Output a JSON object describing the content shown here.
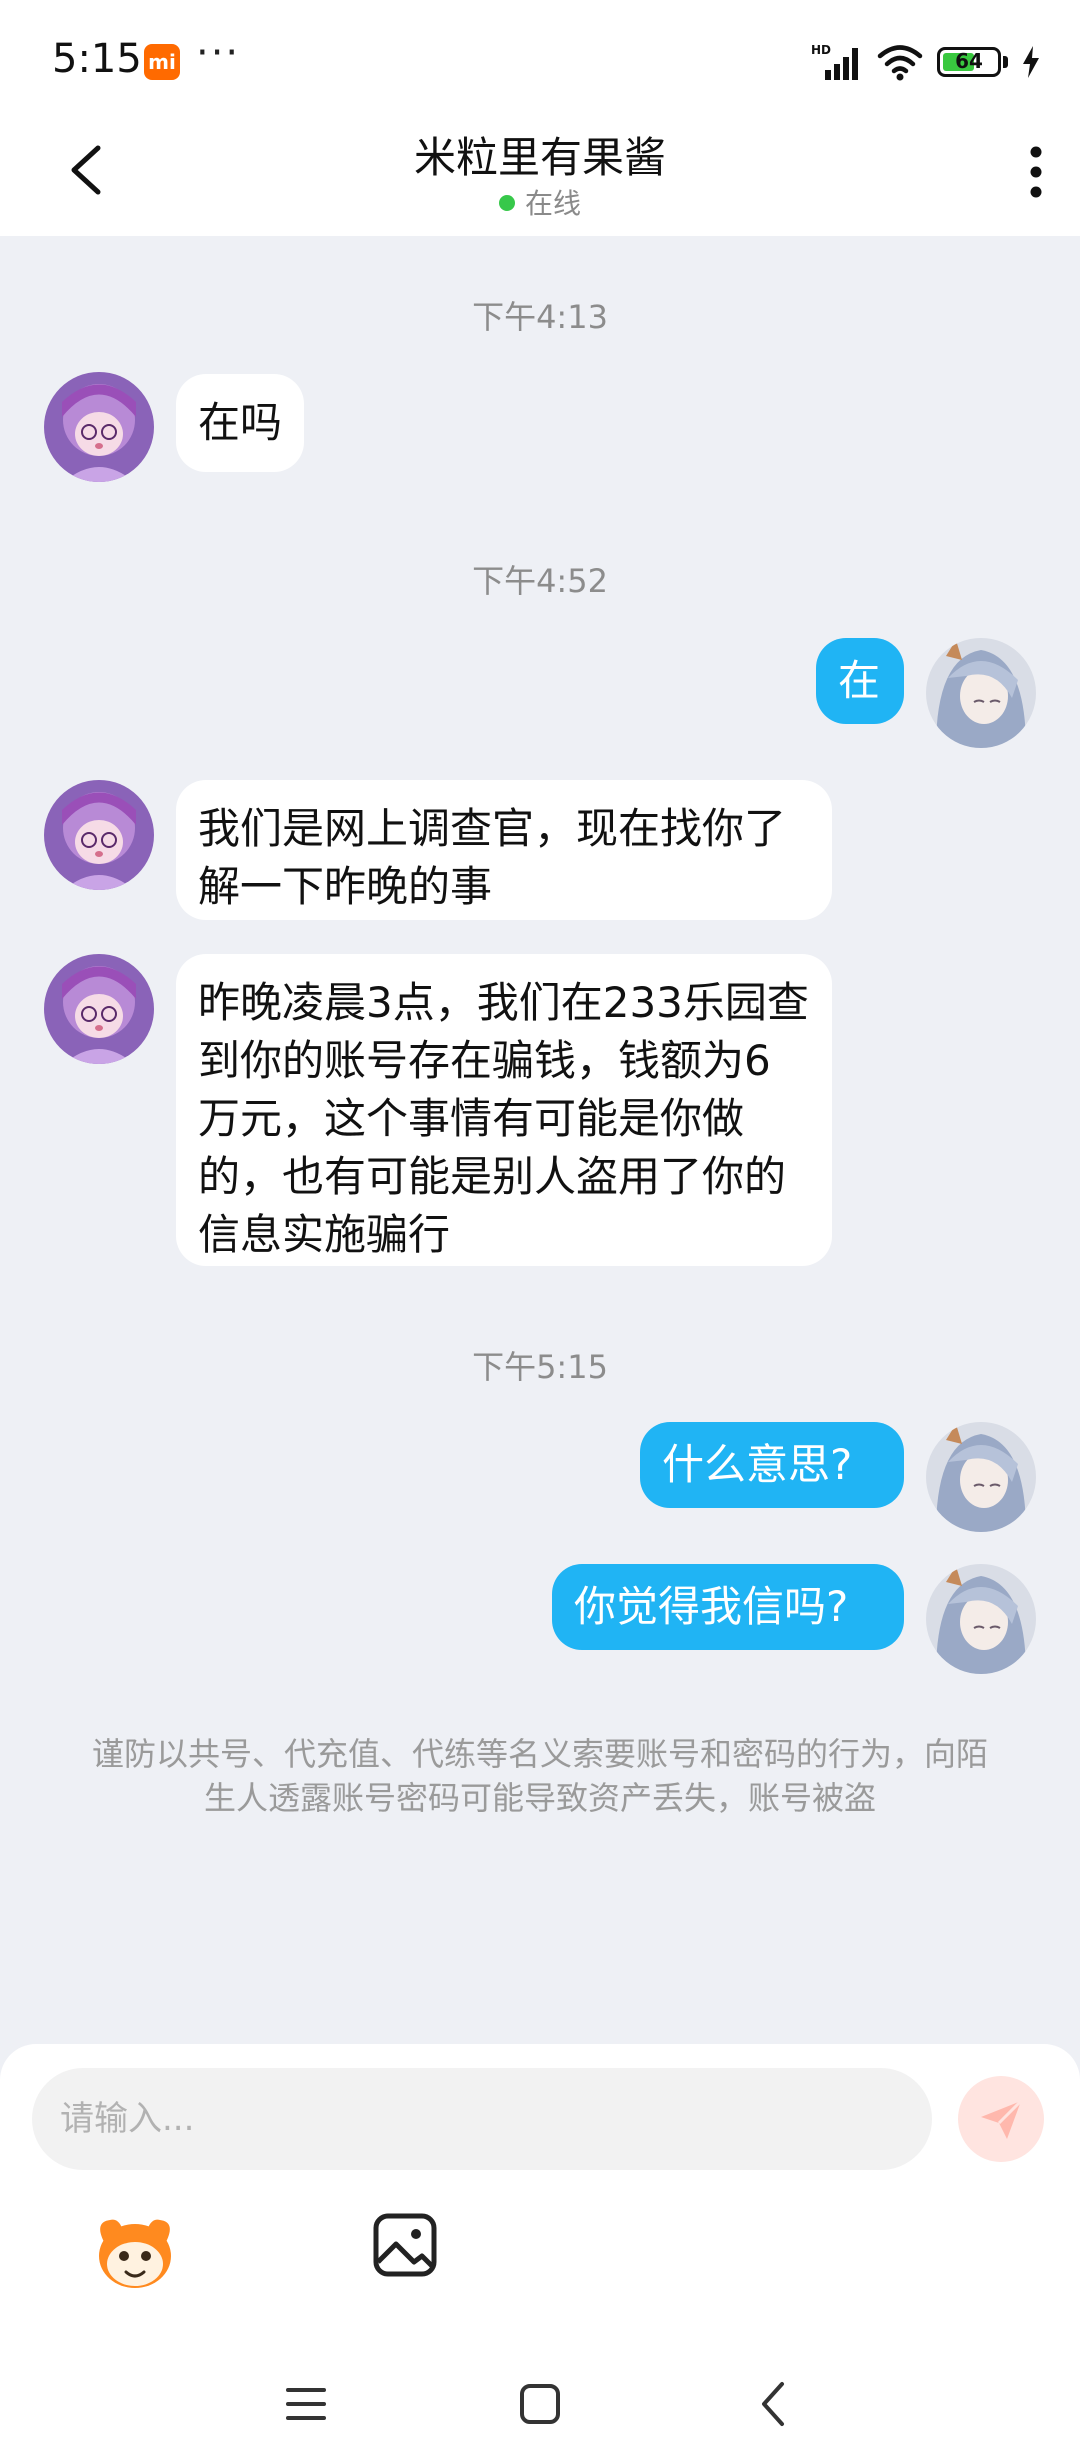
{
  "status_bar": {
    "time": "5:15",
    "mi_badge": "mi",
    "dots": "···",
    "network_label": "HD",
    "battery_level": 64,
    "battery_label": "64"
  },
  "header": {
    "title": "米粒里有果酱",
    "presence": "在线"
  },
  "messages": [
    {
      "timestamp": "下午4:13"
    },
    {
      "side": "left",
      "text": "在吗"
    },
    {
      "timestamp": "下午4:52"
    },
    {
      "side": "right",
      "text": "在"
    },
    {
      "side": "left",
      "text": "我们是网上调查官，现在找你了解一下昨晚的事"
    },
    {
      "side": "left",
      "text": "昨晚凌晨3点，我们在233乐园查到你的账号存在骗钱，钱额为6万元，这个事情有可能是你做的，也有可能是别人盗用了你的信息实施骗行"
    },
    {
      "timestamp": "下午5:15"
    },
    {
      "side": "right",
      "text": "什么意思?"
    },
    {
      "side": "right",
      "text": "你觉得我信吗?"
    }
  ],
  "notice": "谨防以共号、代充值、代练等名义索要账号和密码的行为，向陌生人透露账号密码可能导致资产丢失，账号被盗",
  "composer": {
    "placeholder": "请输入..."
  },
  "colors": {
    "accent_bubble": "#20b4f4",
    "online_dot": "#37c84a",
    "send_button": "#ffe4e0"
  },
  "icons": [
    "back-icon",
    "more-icon",
    "send-icon",
    "emoji-icon",
    "image-icon",
    "menu-icon",
    "home-icon",
    "back-nav-icon"
  ]
}
